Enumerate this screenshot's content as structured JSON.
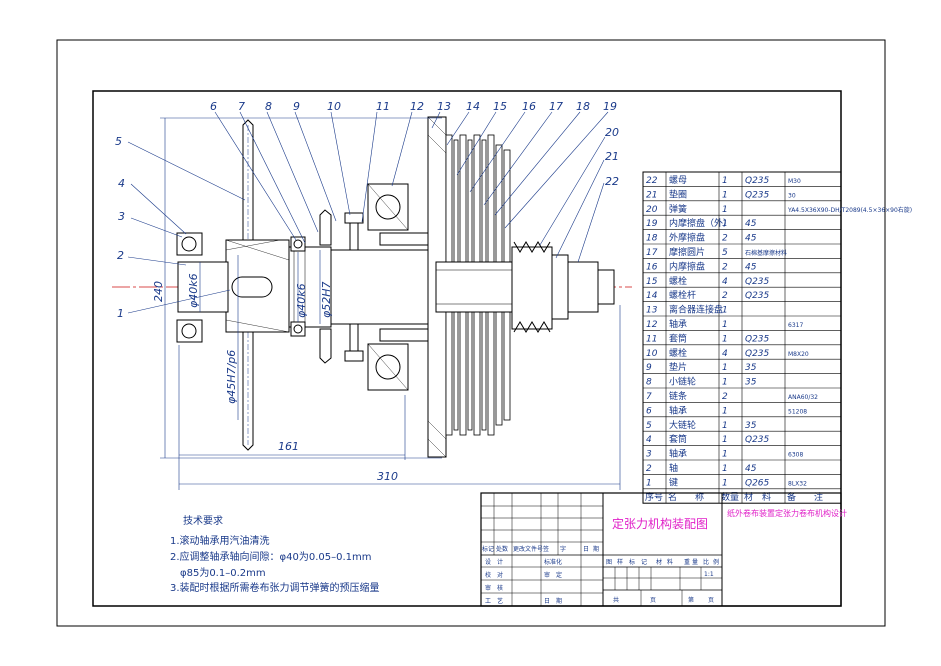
{
  "drawing": {
    "part_numbers": [
      "1",
      "2",
      "3",
      "4",
      "5",
      "6",
      "7",
      "8",
      "9",
      "10",
      "11",
      "12",
      "13",
      "14",
      "15",
      "16",
      "17",
      "18",
      "19",
      "20",
      "21",
      "22"
    ],
    "dimensions": {
      "d_shaft_left": "φ40k6",
      "d_hub": "φ45H7/p6",
      "d_shaft_mid": "φ40k6",
      "d_bore": "φ52H7",
      "height": "240",
      "len_161": "161",
      "len_310": "310"
    }
  },
  "bom": {
    "rows": [
      {
        "no": "22",
        "name": "螺母",
        "qty": "1",
        "material": "Q235",
        "note": "M30"
      },
      {
        "no": "21",
        "name": "垫圈",
        "qty": "1",
        "material": "Q235",
        "note": "30"
      },
      {
        "no": "20",
        "name": "弹簧",
        "qty": "1",
        "material": "",
        "note": "YA4.5X36X90-DH/T2089(4.5×36×90右旋)"
      },
      {
        "no": "19",
        "name": "内摩擦盘（外）",
        "qty": "1",
        "material": "45",
        "note": ""
      },
      {
        "no": "18",
        "name": "外摩擦盘",
        "qty": "2",
        "material": "45",
        "note": ""
      },
      {
        "no": "17",
        "name": "摩擦圆片",
        "qty": "5",
        "material": "石棉基摩擦材料",
        "note": ""
      },
      {
        "no": "16",
        "name": "内摩擦盘",
        "qty": "2",
        "material": "45",
        "note": ""
      },
      {
        "no": "15",
        "name": "螺栓",
        "qty": "4",
        "material": "Q235",
        "note": ""
      },
      {
        "no": "14",
        "name": "螺栓杆",
        "qty": "2",
        "material": "Q235",
        "note": ""
      },
      {
        "no": "13",
        "name": "离合器连接盘",
        "qty": "1",
        "material": "",
        "note": ""
      },
      {
        "no": "12",
        "name": "轴承",
        "qty": "1",
        "material": "",
        "note": "6317"
      },
      {
        "no": "11",
        "name": "套筒",
        "qty": "1",
        "material": "Q235",
        "note": ""
      },
      {
        "no": "10",
        "name": "螺栓",
        "qty": "4",
        "material": "Q235",
        "note": "M8X20"
      },
      {
        "no": "9",
        "name": "垫片",
        "qty": "1",
        "material": "35",
        "note": ""
      },
      {
        "no": "8",
        "name": "小链轮",
        "qty": "1",
        "material": "35",
        "note": ""
      },
      {
        "no": "7",
        "name": "链条",
        "qty": "2",
        "material": "",
        "note": "ANA60/32"
      },
      {
        "no": "6",
        "name": "轴承",
        "qty": "1",
        "material": "",
        "note": "51208"
      },
      {
        "no": "5",
        "name": "大链轮",
        "qty": "1",
        "material": "35",
        "note": ""
      },
      {
        "no": "4",
        "name": "套筒",
        "qty": "1",
        "material": "Q235",
        "note": ""
      },
      {
        "no": "3",
        "name": "轴承",
        "qty": "1",
        "material": "",
        "note": "6308"
      },
      {
        "no": "2",
        "name": "轴",
        "qty": "1",
        "material": "45",
        "note": ""
      },
      {
        "no": "1",
        "name": "键",
        "qty": "1",
        "material": "Q265",
        "note": "8LX32"
      }
    ],
    "header": {
      "no": "序号",
      "name": "名　　称",
      "qty": "数量",
      "material": "材　料",
      "note": "备　　注"
    }
  },
  "tech": {
    "title": "技术要求",
    "lines": [
      "1.滚动轴承用汽油清洗",
      "2.应调整轴承轴向间隙：φ40为0.05–0.1mm",
      "　φ85为0.1–0.2mm",
      "3.装配时根据所需卷布张力调节弹簧的预压缩量"
    ]
  },
  "title_block": {
    "drawing_name": "定张力机构装配图",
    "project": "纸外卷布装置定张力卷布机构设计",
    "revision_cols": [
      "标记",
      "处数",
      "更改文件号",
      "签",
      "字",
      "日",
      "期"
    ],
    "roles": [
      "设　计",
      "标准化",
      "校　对",
      "审　定",
      "审　核",
      "",
      "工　艺",
      "日　期"
    ],
    "stage_cols": [
      "图",
      "样",
      "标",
      "记",
      "材",
      "料",
      "重",
      "量",
      "比",
      "例"
    ],
    "scale": "1:1",
    "sheet": [
      "共",
      "页",
      "第",
      "页"
    ]
  },
  "colors": {
    "ink": "#1a3a8a",
    "center": "#cc1111",
    "title": "#e020c8"
  }
}
